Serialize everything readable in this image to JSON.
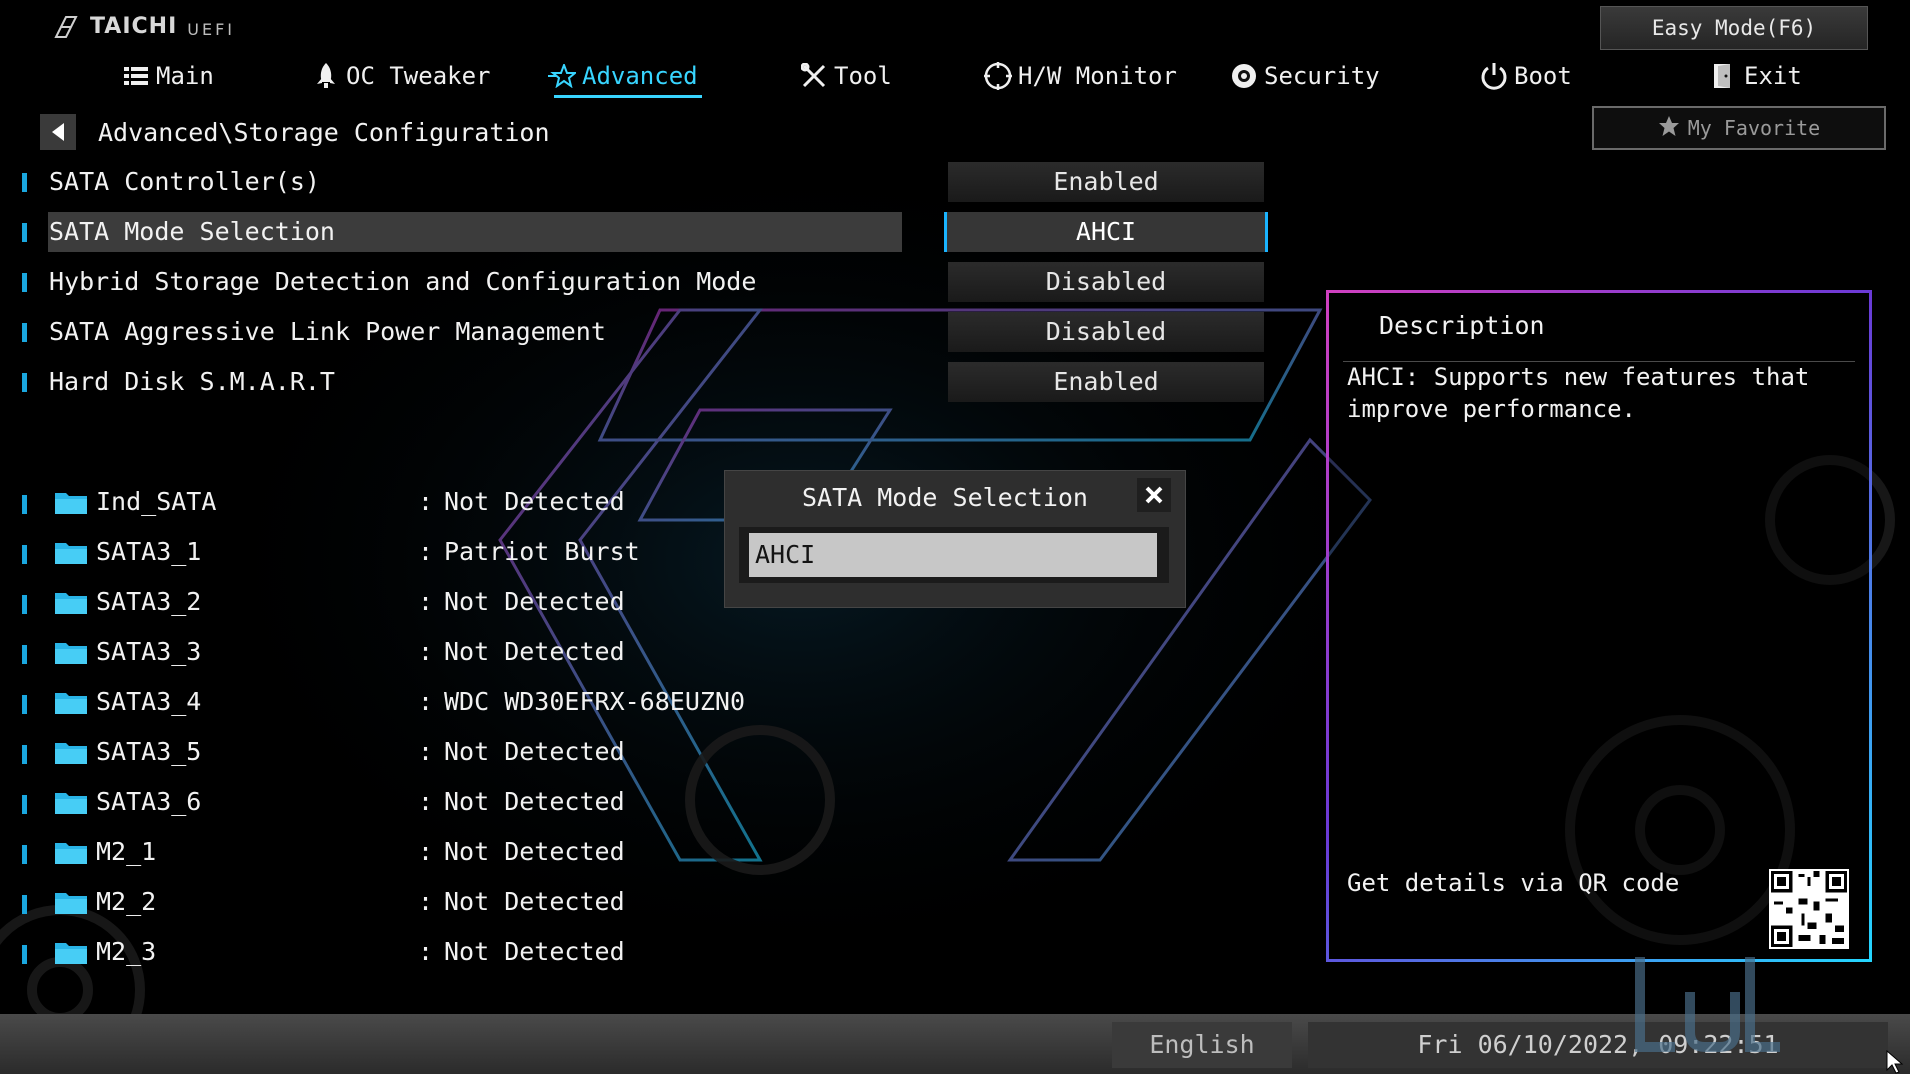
{
  "brand": {
    "name": "TAICHI",
    "sub": "UEFI"
  },
  "header": {
    "easy_mode_label": "Easy Mode(F6)",
    "favorite_label": "My Favorite",
    "tabs": [
      {
        "label": "Main",
        "icon": "list-icon"
      },
      {
        "label": "OC Tweaker",
        "icon": "rocket-icon"
      },
      {
        "label": "Advanced",
        "icon": "star-icon",
        "active": true
      },
      {
        "label": "Tool",
        "icon": "tools-icon"
      },
      {
        "label": "H/W Monitor",
        "icon": "monitor-icon"
      },
      {
        "label": "Security",
        "icon": "shield-icon"
      },
      {
        "label": "Boot",
        "icon": "power-icon"
      },
      {
        "label": "Exit",
        "icon": "exit-door-icon"
      }
    ]
  },
  "breadcrumb": {
    "path": "Advanced\\Storage Configuration"
  },
  "settings": [
    {
      "label": "SATA Controller(s)",
      "value": "Enabled"
    },
    {
      "label": "SATA Mode Selection",
      "value": "AHCI",
      "selected": true
    },
    {
      "label": "Hybrid Storage Detection and Configuration Mode",
      "value": "Disabled"
    },
    {
      "label": "SATA Aggressive Link Power Management",
      "value": "Disabled"
    },
    {
      "label": "Hard Disk S.M.A.R.T",
      "value": "Enabled"
    }
  ],
  "devices": [
    {
      "name": "Ind_SATA",
      "sep": ":",
      "value": "Not Detected"
    },
    {
      "name": "SATA3_1",
      "sep": ":",
      "value": "Patriot Burst"
    },
    {
      "name": "SATA3_2",
      "sep": ":",
      "value": "Not Detected"
    },
    {
      "name": "SATA3_3",
      "sep": ":",
      "value": "Not Detected"
    },
    {
      "name": "SATA3_4",
      "sep": ":",
      "value": "WDC WD30EFRX-68EUZN0"
    },
    {
      "name": "SATA3_5",
      "sep": ":",
      "value": "Not Detected"
    },
    {
      "name": "SATA3_6",
      "sep": ":",
      "value": "Not Detected"
    },
    {
      "name": "M2_1",
      "sep": ":",
      "value": "Not Detected"
    },
    {
      "name": "M2_2",
      "sep": ":",
      "value": "Not Detected"
    },
    {
      "name": "M2_3",
      "sep": ":",
      "value": "Not Detected"
    }
  ],
  "popup": {
    "title": "SATA Mode Selection",
    "option": "AHCI"
  },
  "description": {
    "title": "Description",
    "text": "AHCI: Supports new features that improve performance.",
    "qr_label": "Get details via QR code"
  },
  "footer": {
    "language": "English",
    "datetime": "Fri 06/10/2022, 09:22:51"
  },
  "colors": {
    "accent": "#38d5ff",
    "bar": "#1aa7df",
    "panel_pink": "#d040c0",
    "panel_cyan": "#24d6ff"
  }
}
